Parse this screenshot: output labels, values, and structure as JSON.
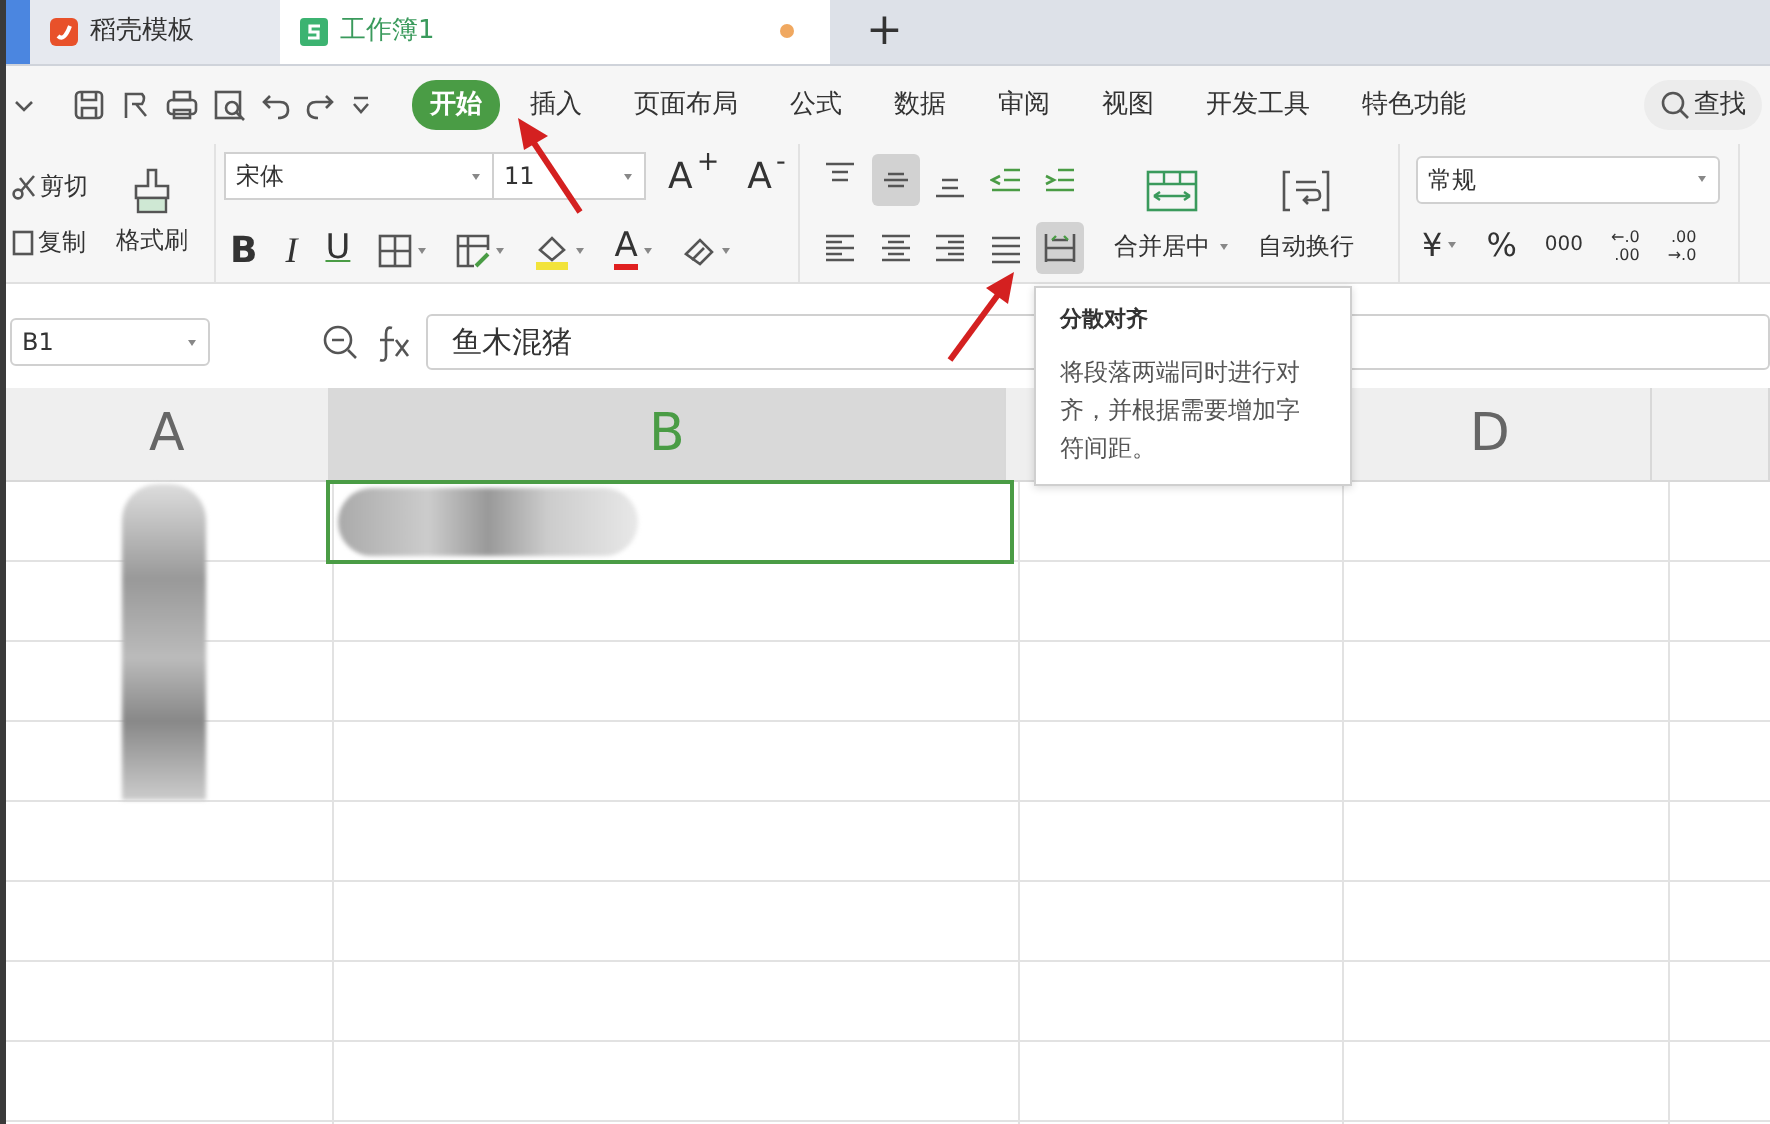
{
  "doc_tabs": [
    {
      "kind": "docer",
      "label": "稻壳模板",
      "selected": false
    },
    {
      "kind": "sheet",
      "label": "工作簿1",
      "selected": true,
      "unsaved": true
    }
  ],
  "new_tab": "+",
  "ribbon_tabs": [
    {
      "label": "开始",
      "selected": true
    },
    {
      "label": "插入",
      "selected": false
    },
    {
      "label": "页面布局",
      "selected": false
    },
    {
      "label": "公式",
      "selected": false
    },
    {
      "label": "数据",
      "selected": false
    },
    {
      "label": "审阅",
      "selected": false
    },
    {
      "label": "视图",
      "selected": false
    },
    {
      "label": "开发工具",
      "selected": false
    },
    {
      "label": "特色功能",
      "selected": false
    }
  ],
  "search": "查找",
  "clipboard": {
    "cut": "剪切",
    "copy": "复制",
    "painter": "格式刷"
  },
  "font": {
    "name": "宋体",
    "size": "11",
    "grow": "A$^{+}$",
    "shrink": "A$^{-}$",
    "bold": "B",
    "italic": "I",
    "underline": "U",
    "color_label": "A"
  },
  "align_top": [
    {
      "kind": "top",
      "selected": false
    },
    {
      "kind": "middle",
      "selected": true
    },
    {
      "kind": "bottom",
      "selected": false
    },
    {
      "kind": "outdent",
      "selected": false
    },
    {
      "kind": "indent",
      "selected": false
    }
  ],
  "align_bottom": [
    {
      "kind": "left",
      "selected": false
    },
    {
      "kind": "center",
      "selected": false
    },
    {
      "kind": "right",
      "selected": false
    },
    {
      "kind": "justify",
      "selected": false
    },
    {
      "kind": "distributed",
      "selected": true
    }
  ],
  "merge": "合并居中",
  "wrap": "自动换行",
  "number_format": "常规",
  "number_buttons": [
    {
      "kind": "single",
      "label": "¥"
    },
    {
      "kind": "single",
      "label": "%"
    },
    {
      "kind": "single",
      "label": "000"
    },
    {
      "kind": "stack",
      "top": "←.0",
      "bottom": ".00"
    },
    {
      "kind": "stack",
      "top": ".00",
      "bottom": "→.0"
    }
  ],
  "cell_ref": "B1",
  "formula": "鱼木混猪",
  "tooltip": {
    "title": "分散对齐",
    "text": "将段落两端同时进行对齐，并根据需要增加字符间距。"
  },
  "columns": [
    {
      "label": "A",
      "selected": false
    },
    {
      "label": "B",
      "selected": true
    },
    {
      "label": "D",
      "selected": false
    },
    {
      "selected": false
    }
  ]
}
